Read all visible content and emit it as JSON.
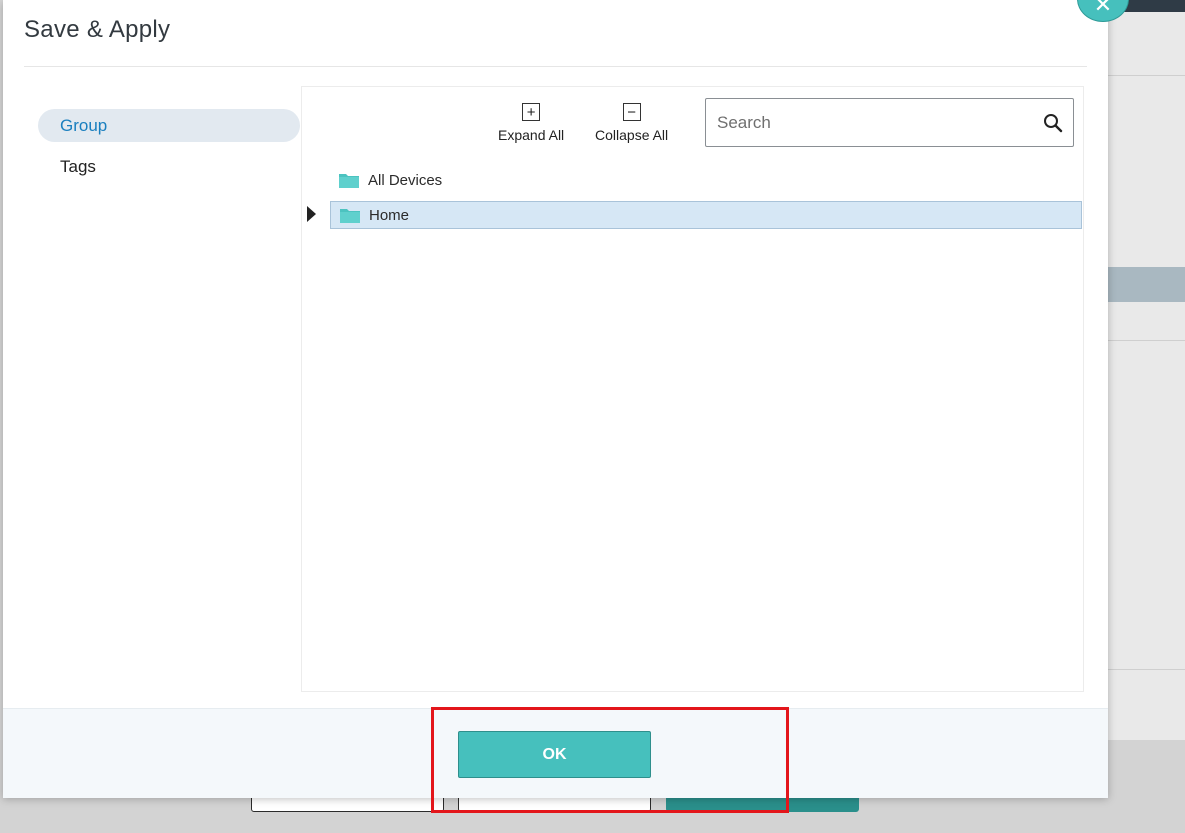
{
  "modal": {
    "title": "Save & Apply",
    "close_icon": "close-icon"
  },
  "sidebar": {
    "items": [
      {
        "label": "Group",
        "active": true
      },
      {
        "label": "Tags",
        "active": false
      }
    ]
  },
  "toolbar": {
    "expand_all_label": "Expand All",
    "expand_icon": "plus-square-icon",
    "collapse_all_label": "Collapse All",
    "collapse_icon": "minus-square-icon"
  },
  "search": {
    "placeholder": "Search",
    "value": "",
    "icon": "search-icon"
  },
  "tree": {
    "nodes": [
      {
        "label": "All Devices",
        "icon": "folder-icon",
        "selected": false,
        "expandable": false
      },
      {
        "label": "Home",
        "icon": "folder-icon",
        "selected": true,
        "expandable": true
      }
    ]
  },
  "footer": {
    "ok_label": "OK"
  },
  "colors": {
    "accent": "#46c0bd",
    "active_nav_text": "#1a7fbf",
    "selected_row": "#d6e7f5",
    "highlight": "#e3161b"
  }
}
